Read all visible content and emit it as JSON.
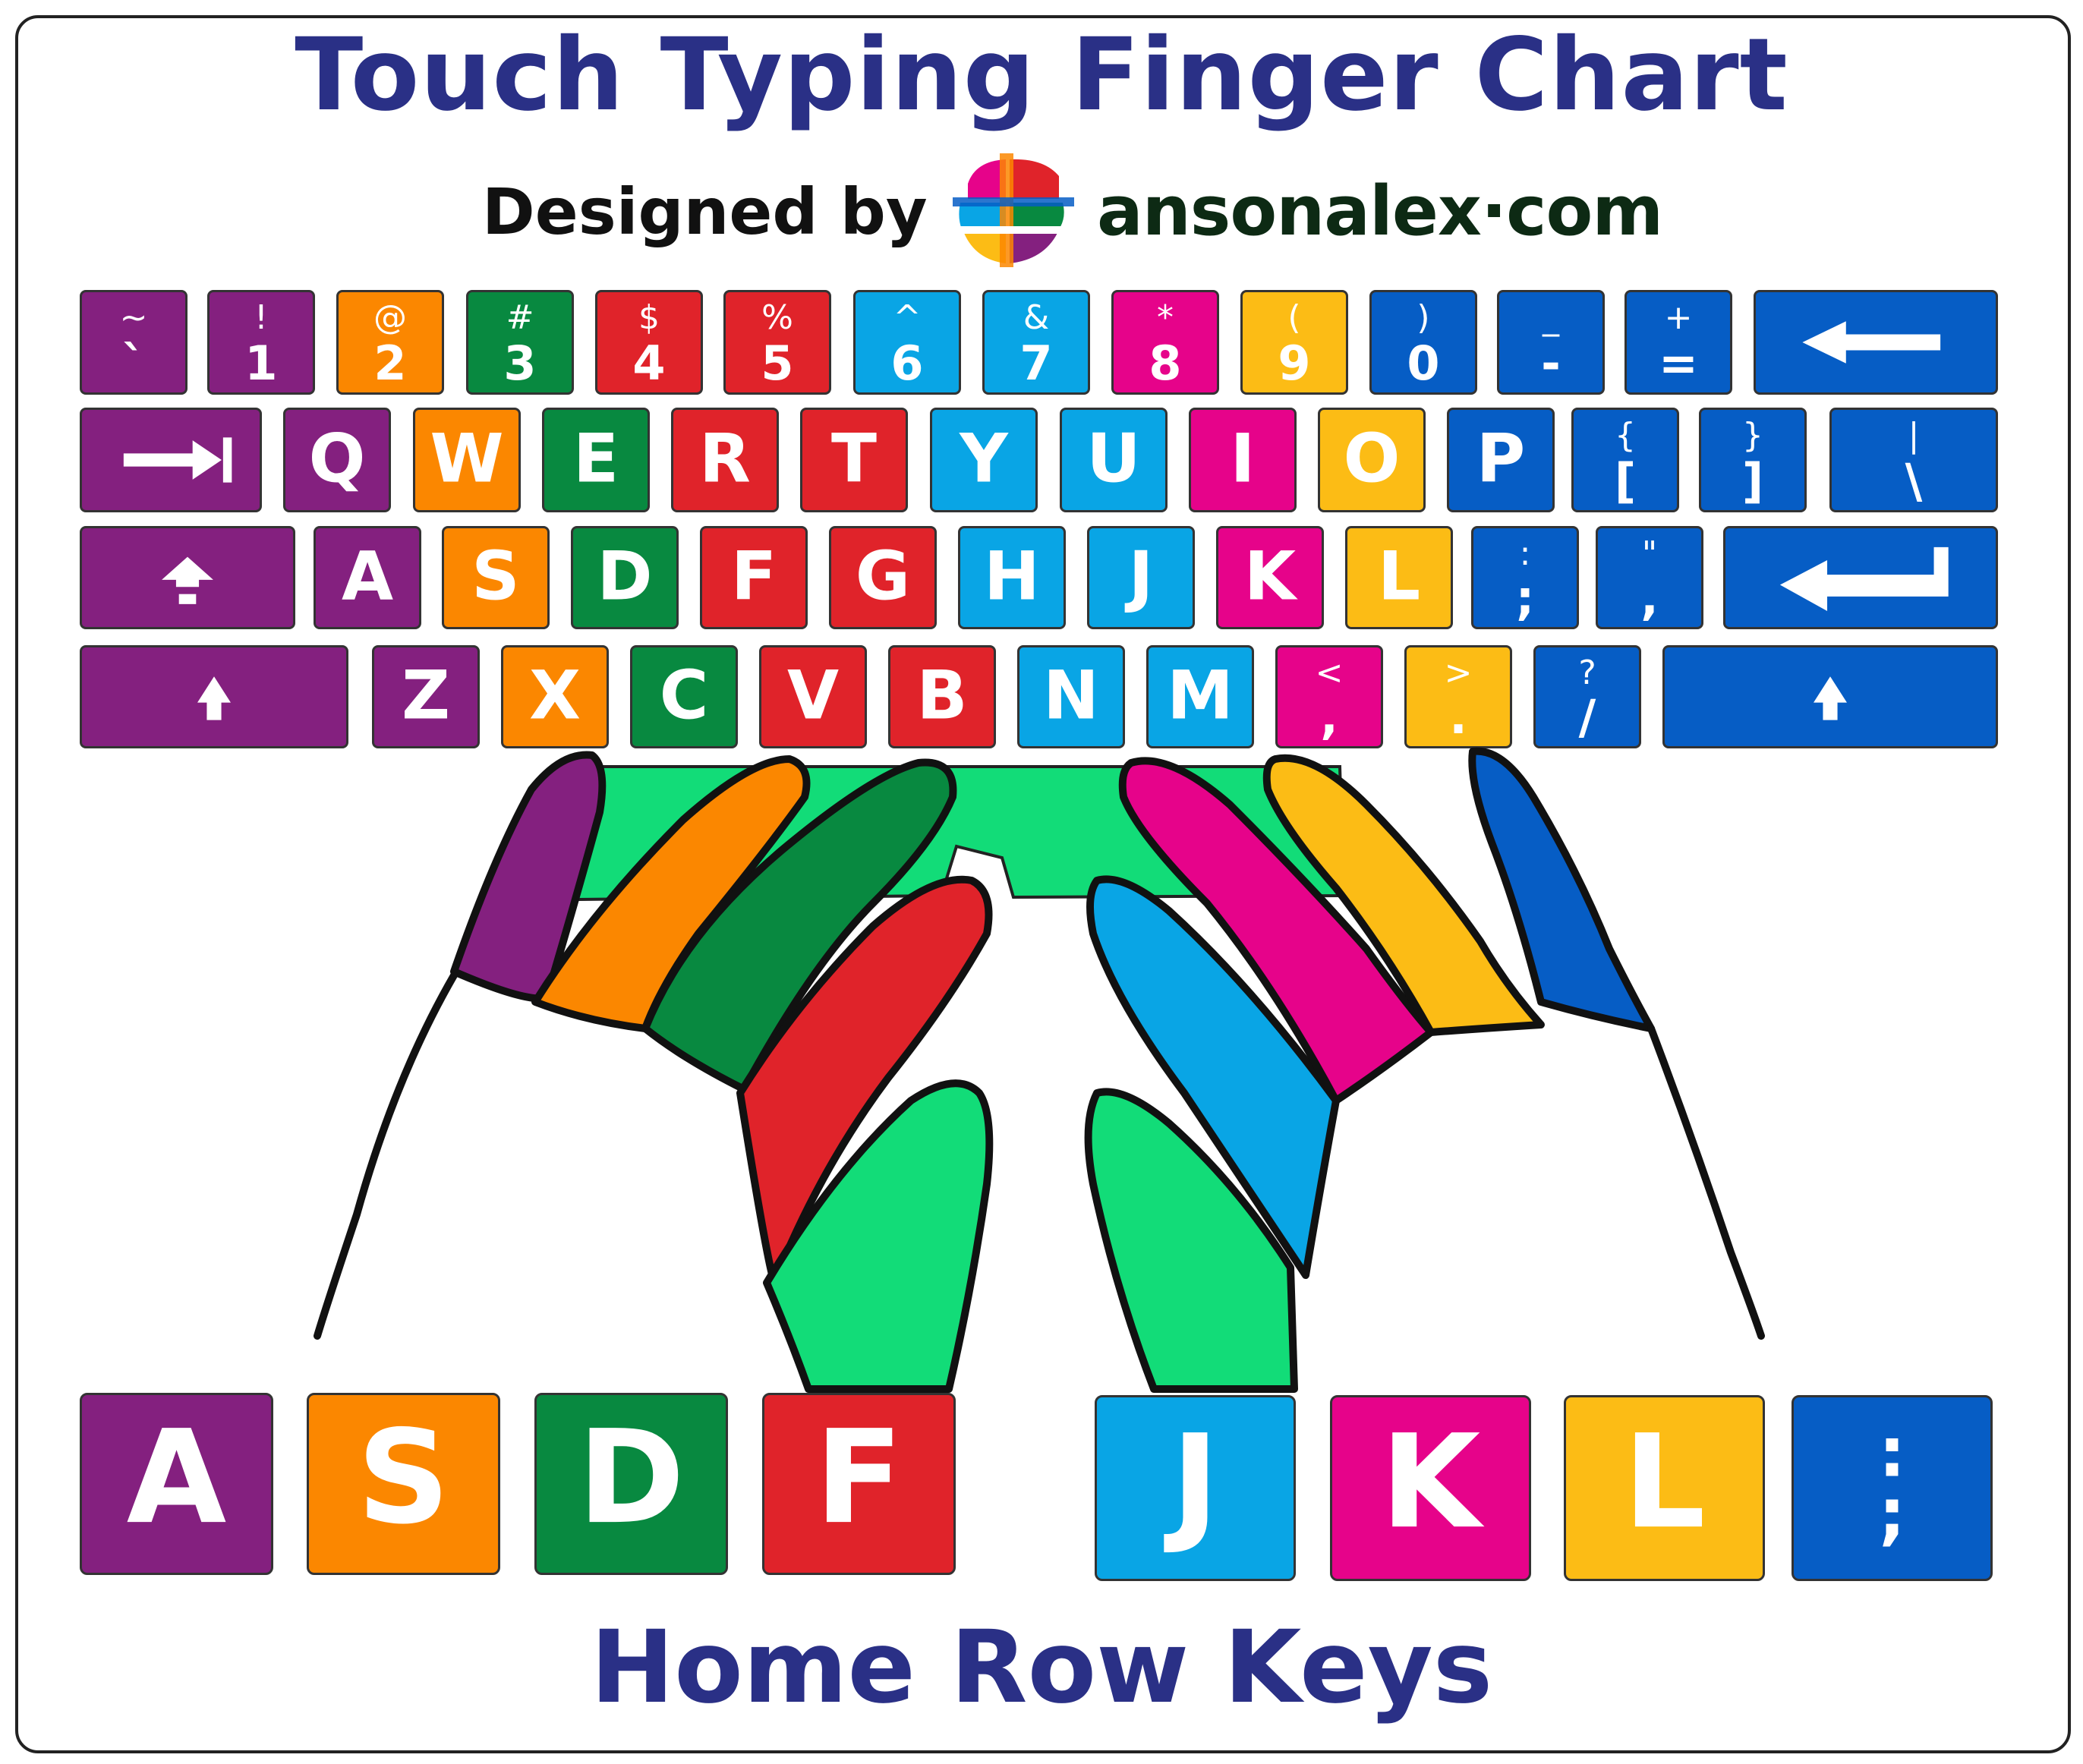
{
  "title": "Touch Typing Finger Chart",
  "credit": {
    "label": "Designed by",
    "brand_main": "ansonalex",
    "brand_dot": "·",
    "brand_tld": "com",
    "logo_icon": "ansonalex-logo-icon"
  },
  "finger_colors": {
    "left_pinky": "#84207f",
    "left_ring": "#fb8700",
    "left_middle": "#088940",
    "left_index": "#e0232a",
    "right_index": "#09a5e5",
    "right_middle": "#e6038a",
    "right_ring": "#fcbc15",
    "right_pinky": "#065dc5",
    "thumbs": "#12dc78"
  },
  "keyboard": {
    "row1": [
      {
        "id": "backtick",
        "top": "~",
        "bottom": "`",
        "color": "purple"
      },
      {
        "id": "1",
        "top": "!",
        "bottom": "1",
        "color": "purple"
      },
      {
        "id": "2",
        "top": "@",
        "bottom": "2",
        "color": "orange"
      },
      {
        "id": "3",
        "top": "#",
        "bottom": "3",
        "color": "dgreen"
      },
      {
        "id": "4",
        "top": "$",
        "bottom": "4",
        "color": "red"
      },
      {
        "id": "5",
        "top": "%",
        "bottom": "5",
        "color": "red"
      },
      {
        "id": "6",
        "top": "^",
        "bottom": "6",
        "color": "lblue"
      },
      {
        "id": "7",
        "top": "&",
        "bottom": "7",
        "color": "lblue"
      },
      {
        "id": "8",
        "top": "*",
        "bottom": "8",
        "color": "pink"
      },
      {
        "id": "9",
        "top": "(",
        "bottom": "9",
        "color": "yellow"
      },
      {
        "id": "0",
        "top": ")",
        "bottom": "0",
        "color": "blue"
      },
      {
        "id": "minus",
        "top": "_",
        "bottom": "-",
        "color": "blue"
      },
      {
        "id": "equals",
        "top": "+",
        "bottom": "=",
        "color": "blue"
      },
      {
        "id": "backspace",
        "icon": "backspace-arrow-icon",
        "color": "blue"
      }
    ],
    "row2": [
      {
        "id": "tab",
        "icon": "tab-arrow-icon",
        "color": "purple"
      },
      {
        "id": "q",
        "label": "Q",
        "color": "purple"
      },
      {
        "id": "w",
        "label": "W",
        "color": "orange"
      },
      {
        "id": "e",
        "label": "E",
        "color": "dgreen"
      },
      {
        "id": "r",
        "label": "R",
        "color": "red"
      },
      {
        "id": "t",
        "label": "T",
        "color": "red"
      },
      {
        "id": "y",
        "label": "Y",
        "color": "lblue"
      },
      {
        "id": "u",
        "label": "U",
        "color": "lblue"
      },
      {
        "id": "i",
        "label": "I",
        "color": "pink"
      },
      {
        "id": "o",
        "label": "O",
        "color": "yellow"
      },
      {
        "id": "p",
        "label": "P",
        "color": "blue"
      },
      {
        "id": "lbracket",
        "top": "{",
        "bottom": "[",
        "color": "blue"
      },
      {
        "id": "rbracket",
        "top": "}",
        "bottom": "]",
        "color": "blue"
      },
      {
        "id": "backslash",
        "top": "|",
        "bottom": "\\",
        "color": "blue"
      }
    ],
    "row3": [
      {
        "id": "capslock",
        "icon": "caps-lock-icon",
        "color": "purple"
      },
      {
        "id": "a",
        "label": "A",
        "color": "purple"
      },
      {
        "id": "s",
        "label": "S",
        "color": "orange"
      },
      {
        "id": "d",
        "label": "D",
        "color": "dgreen"
      },
      {
        "id": "f",
        "label": "F",
        "color": "red"
      },
      {
        "id": "g",
        "label": "G",
        "color": "red"
      },
      {
        "id": "h",
        "label": "H",
        "color": "lblue"
      },
      {
        "id": "j",
        "label": "J",
        "color": "lblue"
      },
      {
        "id": "k",
        "label": "K",
        "color": "pink"
      },
      {
        "id": "l",
        "label": "L",
        "color": "yellow"
      },
      {
        "id": "semicolon",
        "top": ":",
        "bottom": ";",
        "color": "blue"
      },
      {
        "id": "quote",
        "top": "\"",
        "bottom": ",",
        "color": "blue"
      },
      {
        "id": "enter",
        "icon": "enter-arrow-icon",
        "color": "blue"
      }
    ],
    "row4": [
      {
        "id": "lshift",
        "icon": "shift-arrow-icon",
        "color": "purple"
      },
      {
        "id": "z",
        "label": "Z",
        "color": "purple"
      },
      {
        "id": "x",
        "label": "X",
        "color": "orange"
      },
      {
        "id": "c",
        "label": "C",
        "color": "dgreen"
      },
      {
        "id": "v",
        "label": "V",
        "color": "red"
      },
      {
        "id": "b",
        "label": "B",
        "color": "red"
      },
      {
        "id": "n",
        "label": "N",
        "color": "lblue"
      },
      {
        "id": "m",
        "label": "M",
        "color": "lblue"
      },
      {
        "id": "comma",
        "top": "<",
        "bottom": ",",
        "color": "pink"
      },
      {
        "id": "period",
        "top": ">",
        "bottom": ".",
        "color": "yellow"
      },
      {
        "id": "slash",
        "top": "?",
        "bottom": "/",
        "color": "blue"
      },
      {
        "id": "rshift",
        "icon": "shift-arrow-icon",
        "color": "blue"
      }
    ]
  },
  "home_row": [
    {
      "id": "a",
      "label": "A",
      "color": "purple"
    },
    {
      "id": "s",
      "label": "S",
      "color": "orange"
    },
    {
      "id": "d",
      "label": "D",
      "color": "dgreen"
    },
    {
      "id": "f",
      "label": "F",
      "color": "red"
    },
    {
      "id": "j",
      "label": "J",
      "color": "lblue"
    },
    {
      "id": "k",
      "label": "K",
      "color": "pink"
    },
    {
      "id": "l",
      "label": "L",
      "color": "yellow"
    },
    {
      "id": "semicolon",
      "label": ":\n;",
      "color": "blue"
    }
  ],
  "footer": "Home Row Keys"
}
